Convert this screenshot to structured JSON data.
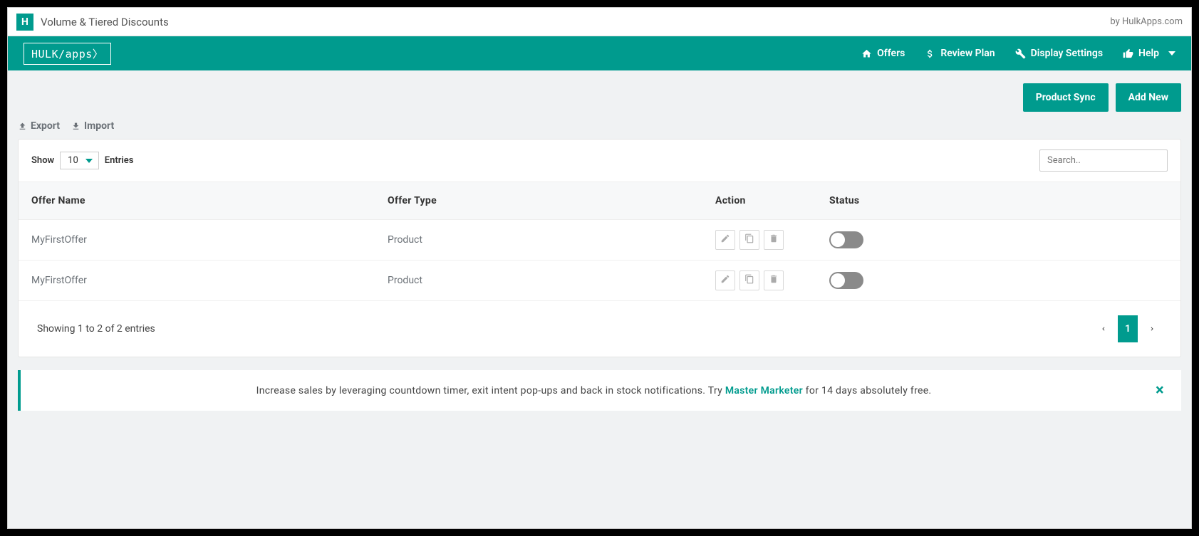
{
  "topbar": {
    "title": "Volume & Tiered Discounts",
    "byline": "by HulkApps.com"
  },
  "brand": "HULK/apps〉",
  "nav": {
    "offers": "Offers",
    "review_plan": "Review Plan",
    "display_settings": "Display Settings",
    "help": "Help"
  },
  "buttons": {
    "product_sync": "Product Sync",
    "add_new": "Add New"
  },
  "links": {
    "export": "Export",
    "import": "Import"
  },
  "table": {
    "show_label": "Show",
    "page_size": "10",
    "entries_label": "Entries",
    "search_placeholder": "Search..",
    "columns": {
      "offer_name": "Offer Name",
      "offer_type": "Offer Type",
      "action": "Action",
      "status": "Status"
    },
    "rows": [
      {
        "name": "MyFirstOffer",
        "type": "Product"
      },
      {
        "name": "MyFirstOffer",
        "type": "Product"
      }
    ],
    "summary": "Showing 1 to 2 of 2 entries",
    "current_page": "1"
  },
  "promo": {
    "before": "Increase sales by leveraging countdown timer, exit intent pop-ups and back in stock notifications. Try ",
    "link": "Master Marketer",
    "after": " for 14 days absolutely free."
  }
}
